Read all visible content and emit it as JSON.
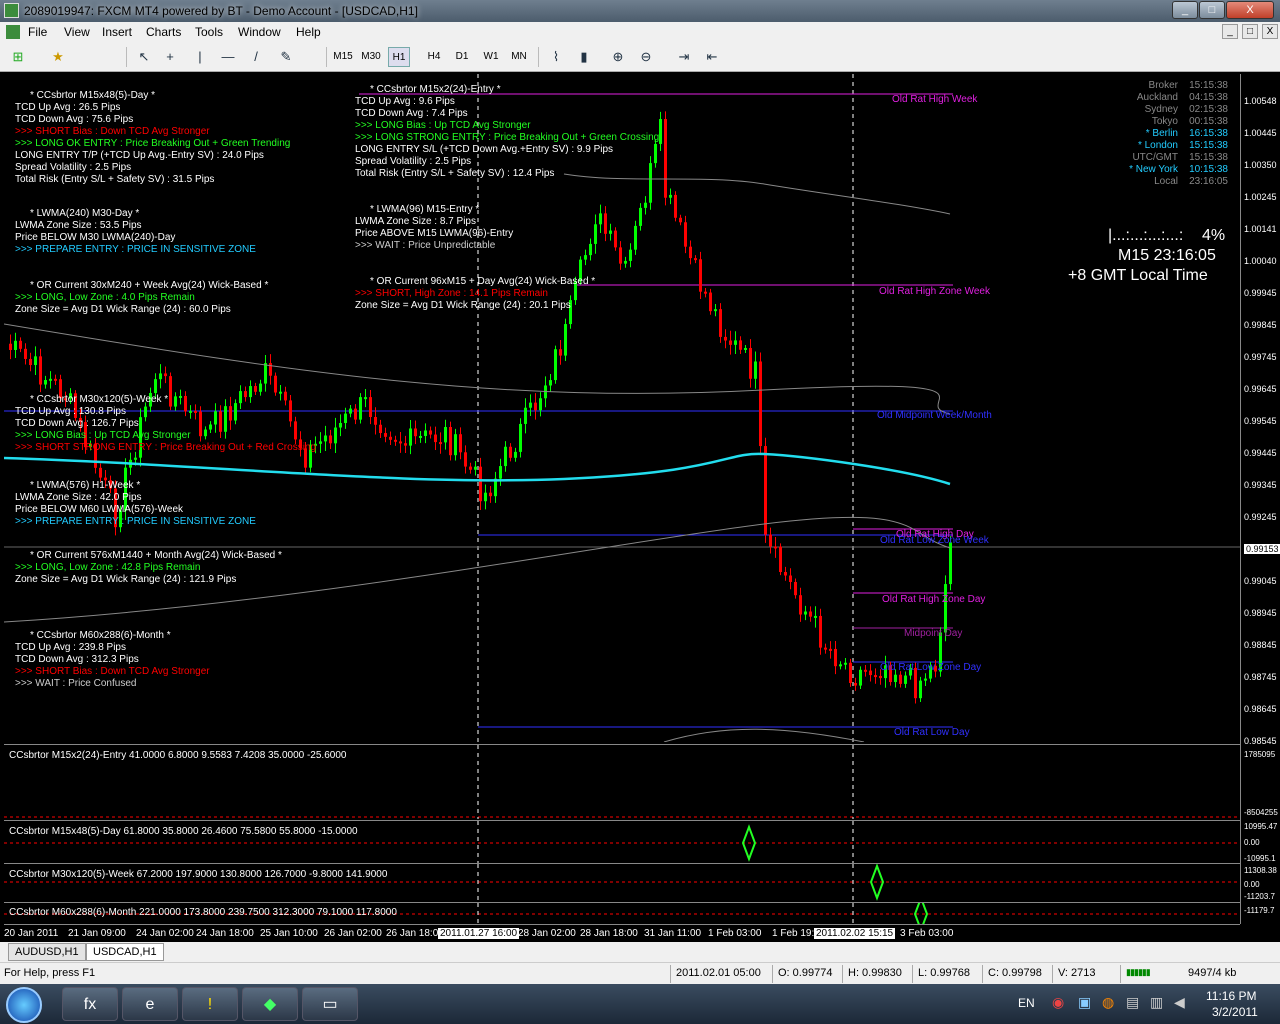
{
  "window": {
    "title": "2089019947: FXCM MT4 powered by BT - Demo Account - [USDCAD,H1]",
    "min": "_",
    "max": "□",
    "close": "X"
  },
  "menu": [
    "File",
    "View",
    "Insert",
    "Charts",
    "Tools",
    "Window",
    "Help"
  ],
  "mdi": [
    "_",
    "□",
    "X"
  ],
  "timeframes": [
    "M15",
    "M30",
    "H1",
    "H4",
    "D1",
    "W1",
    "MN"
  ],
  "active_timeframe": "H1",
  "overlay_left": [
    {
      "t": "* CCsbrtor M15x48(5)-Day *",
      "c": "wht"
    },
    {
      "t": "TCD Up Avg : 26.5 Pips",
      "c": "wht"
    },
    {
      "t": "TCD Down Avg : 75.6 Pips",
      "c": "wht"
    },
    {
      "t": ">>> SHORT Bias : Down TCD Avg Stronger",
      "c": "red"
    },
    {
      "t": ">>> LONG OK ENTRY : Price Breaking Out + Green Trending",
      "c": "grn"
    },
    {
      "t": "LONG ENTRY T/P (+TCD Up Avg.-Entry SV) : 24.0 Pips",
      "c": "wht"
    },
    {
      "t": "Spread Volatility : 2.5 Pips",
      "c": "wht"
    },
    {
      "t": "Total Risk (Entry S/L + Safety SV) : 31.5 Pips",
      "c": "wht"
    },
    {
      "t": "* LWMA(240) M30-Day *",
      "c": "wht"
    },
    {
      "t": "LWMA Zone Size : 53.5 Pips",
      "c": "wht"
    },
    {
      "t": "Price BELOW M30 LWMA(240)-Day",
      "c": "wht"
    },
    {
      "t": ">>> PREPARE ENTRY : PRICE IN SENSITIVE ZONE",
      "c": "cyn"
    },
    {
      "t": "* OR Current 30xM240 + Week Avg(24) Wick-Based *",
      "c": "wht"
    },
    {
      "t": ">>> LONG, Low Zone : 4.0 Pips Remain",
      "c": "grn"
    },
    {
      "t": "Zone Size = Avg D1 Wick Range (24) : 60.0 Pips",
      "c": "wht"
    },
    {
      "t": "* CCsbrtor M30x120(5)-Week *",
      "c": "wht"
    },
    {
      "t": "TCD Up Avg : 130.8 Pips",
      "c": "wht"
    },
    {
      "t": "TCD Down Avg : 126.7 Pips",
      "c": "wht"
    },
    {
      "t": ">>> LONG Bias : Up TCD Avg Stronger",
      "c": "grn"
    },
    {
      "t": ">>> SHORT STRONG ENTRY : Price Breaking Out + Red Crossing",
      "c": "red"
    },
    {
      "t": "* LWMA(576) H1-Week *",
      "c": "wht"
    },
    {
      "t": "LWMA Zone Size : 42.0 Pips",
      "c": "wht"
    },
    {
      "t": "Price BELOW M60 LWMA(576)-Week",
      "c": "wht"
    },
    {
      "t": ">>> PREPARE ENTRY : PRICE IN SENSITIVE ZONE",
      "c": "cyn"
    },
    {
      "t": "* OR Current 576xM1440 + Month Avg(24) Wick-Based *",
      "c": "wht"
    },
    {
      "t": ">>> LONG, Low Zone : 42.8 Pips Remain",
      "c": "grn"
    },
    {
      "t": "Zone Size = Avg D1 Wick Range (24) : 121.9 Pips",
      "c": "wht"
    },
    {
      "t": "* CCsbrtor M60x288(6)-Month *",
      "c": "wht"
    },
    {
      "t": "TCD Up Avg : 239.8 Pips",
      "c": "wht"
    },
    {
      "t": "TCD Down Avg : 312.3 Pips",
      "c": "wht"
    },
    {
      "t": ">>> SHORT Bias : Down TCD Avg Stronger",
      "c": "red"
    },
    {
      "t": ">>> WAIT : Price Confused",
      "c": "gry"
    }
  ],
  "overlay_mid": [
    {
      "t": "* CCsbrtor M15x2(24)-Entry *",
      "c": "wht"
    },
    {
      "t": "TCD Up Avg : 9.6 Pips",
      "c": "wht"
    },
    {
      "t": "TCD Down Avg : 7.4 Pips",
      "c": "wht"
    },
    {
      "t": ">>> LONG Bias : Up TCD Avg Stronger",
      "c": "grn"
    },
    {
      "t": ">>> LONG STRONG ENTRY : Price Breaking Out + Green Crossing",
      "c": "grn"
    },
    {
      "t": "LONG ENTRY S/L (+TCD Down Avg.+Entry SV) : 9.9 Pips",
      "c": "wht"
    },
    {
      "t": "Spread Volatility : 2.5 Pips",
      "c": "wht"
    },
    {
      "t": "Total Risk (Entry S/L + Safety SV) : 12.4 Pips",
      "c": "wht"
    },
    {
      "t": "* LWMA(96) M15-Entry *",
      "c": "wht"
    },
    {
      "t": "LWMA Zone Size : 8.7 Pips",
      "c": "wht"
    },
    {
      "t": "Price ABOVE M15 LWMA(96)-Entry",
      "c": "wht"
    },
    {
      "t": ">>> WAIT : Price Unpredictable",
      "c": "gry"
    },
    {
      "t": "* OR Current 96xM15 + Day Avg(24) Wick-Based *",
      "c": "wht"
    },
    {
      "t": ">>> SHORT, High Zone : 14.1 Pips Remain",
      "c": "red"
    },
    {
      "t": "Zone Size = Avg D1 Wick Range (24) : 20.1 Pips",
      "c": "wht"
    }
  ],
  "zones": [
    {
      "label": "Old Rat High Week",
      "c": "#e020e0"
    },
    {
      "label": "Old Rat High Zone Week",
      "c": "#e020e0"
    },
    {
      "label": "Old Midpoint Week/Month",
      "c": "#3030ff"
    },
    {
      "label": "Old Rat High Day",
      "c": "#e020e0"
    },
    {
      "label": "Old Rat Low Zone Week",
      "c": "#3030ff"
    },
    {
      "label": "Old Rat High Zone Day",
      "c": "#e020e0"
    },
    {
      "label": "Midpoint Day",
      "c": "#a020a0"
    },
    {
      "label": "Old Rat Low Zone Day",
      "c": "#3030ff"
    },
    {
      "label": "Old Rat Low Day",
      "c": "#3030ff"
    }
  ],
  "clocks": [
    {
      "city": "Broker",
      "time": "15:15:38",
      "c": "#888"
    },
    {
      "city": "Auckland",
      "time": "04:15:38",
      "c": "#888"
    },
    {
      "city": "Sydney",
      "time": "02:15:38",
      "c": "#888"
    },
    {
      "city": "Tokyo",
      "time": "00:15:38",
      "c": "#888"
    },
    {
      "city": "* Berlin",
      "time": "16:15:38",
      "c": "#2cf"
    },
    {
      "city": "* London",
      "time": "15:15:38",
      "c": "#2cf"
    },
    {
      "city": "UTC/GMT",
      "time": "15:15:38",
      "c": "#888"
    },
    {
      "city": "* New York",
      "time": "10:15:38",
      "c": "#2cf"
    },
    {
      "city": "Local",
      "time": "23:16:05",
      "c": "#888"
    }
  ],
  "countdown": {
    "bar": "|...:...:...:...:",
    "percent": "4%",
    "tf_time": "M15 23:16:05",
    "local": "+8 GMT Local Time"
  },
  "price_labels": [
    "1.00548",
    "1.00445",
    "1.00350",
    "1.00245",
    "1.00141",
    "1.00040",
    "0.99945",
    "0.99845",
    "0.99745",
    "0.99645",
    "0.99545",
    "0.99445",
    "0.99345",
    "0.99245",
    "0.99153",
    "0.99045",
    "0.98945",
    "0.98845",
    "0.98745",
    "0.98645",
    "0.98545"
  ],
  "current_price": "0.99153",
  "subwindows": [
    {
      "label": "CCsbrtor M15x2(24)-Entry 41.0000 6.8000 9.5583 7.4208 35.0000 -25.6000",
      "scale": [
        "1785095",
        "-8504255"
      ]
    },
    {
      "label": "CCsbrtor M15x48(5)-Day 61.8000 35.8000 26.4600 75.5800 55.8000 -15.0000",
      "scale": [
        "10995.47",
        "0.00",
        "-10995.1"
      ]
    },
    {
      "label": "CCsbrtor M30x120(5)-Week 67.2000 197.9000 130.8000 126.7000 -9.8000 141.9000",
      "scale": [
        "11308.38",
        "0.00",
        "-11203.7"
      ]
    },
    {
      "label": "CCsbrtor M60x288(6)-Month 221.0000 173.8000 239.7500 312.3000 79.1000 117.8000",
      "scale": [
        "-11179.7"
      ]
    }
  ],
  "time_labels": [
    {
      "t": "20 Jan 2011",
      "hl": false
    },
    {
      "t": "21 Jan 09:00",
      "hl": false
    },
    {
      "t": "24 Jan 02:00",
      "hl": false
    },
    {
      "t": "24 Jan 18:00",
      "hl": false
    },
    {
      "t": "25 Jan 10:00",
      "hl": false
    },
    {
      "t": "26 Jan 02:00",
      "hl": false
    },
    {
      "t": "26 Jan 18:00",
      "hl": false
    },
    {
      "t": "2011.01.27 16:00",
      "hl": true
    },
    {
      "t": "28 Jan 02:00",
      "hl": false
    },
    {
      "t": "28 Jan 18:00",
      "hl": false
    },
    {
      "t": "31 Jan 11:00",
      "hl": false
    },
    {
      "t": "1 Feb 03:00",
      "hl": false
    },
    {
      "t": "1 Feb 19:",
      "hl": false
    },
    {
      "t": "2011.02.02 15:15",
      "hl": true
    },
    {
      "t": "3 Feb 03:00",
      "hl": false
    }
  ],
  "tabs": [
    "AUDUSD,H1",
    "USDCAD,H1"
  ],
  "active_tab": "USDCAD,H1",
  "status": {
    "help": "For Help, press F1",
    "datetime": "2011.02.01 05:00",
    "open": "O: 0.99774",
    "high": "H: 0.99830",
    "low": "L: 0.99768",
    "close": "C: 0.99798",
    "volume": "V: 2713",
    "traffic": "9497/4 kb"
  },
  "taskbar": {
    "lang": "EN",
    "time": "11:16 PM",
    "date": "3/2/2011",
    "apps": [
      "fx",
      "e",
      "!",
      "◆",
      "▭"
    ]
  },
  "colors": {
    "bull": "#00ff00",
    "bear": "#ff0000",
    "ma_fast": "#22ddee",
    "ma_slow": "#888888"
  }
}
